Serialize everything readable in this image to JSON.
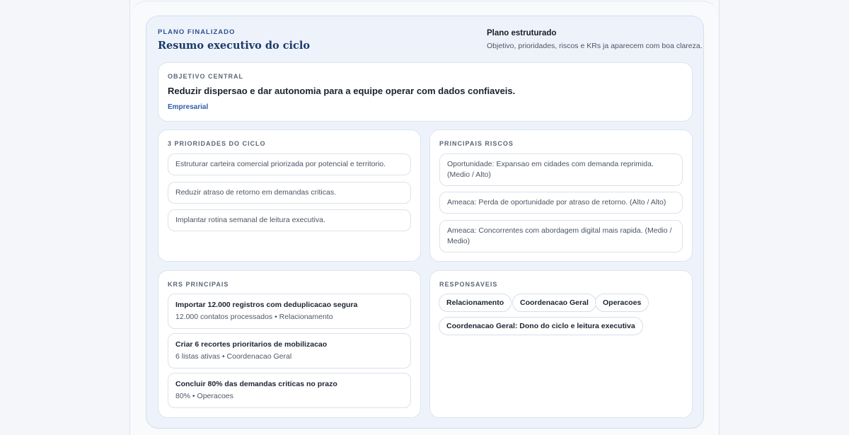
{
  "header": {
    "eyebrow": "PLANO FINALIZADO",
    "title": "Resumo executivo do ciclo",
    "side_title": "Plano estruturado",
    "side_sub": "Objetivo, prioridades, riscos e KRs ja aparecem com boa clareza."
  },
  "objective": {
    "label": "OBJETIVO CENTRAL",
    "text": "Reduzir dispersao e dar autonomia para a equipe operar com dados confiaveis.",
    "tag": "Empresarial"
  },
  "priorities": {
    "label": "3 PRIORIDADES DO CICLO",
    "items": [
      "Estruturar carteira comercial priorizada por potencial e territorio.",
      "Reduzir atraso de retorno em demandas criticas.",
      "Implantar rotina semanal de leitura executiva."
    ]
  },
  "risks": {
    "label": "PRINCIPAIS RISCOS",
    "items": [
      "Oportunidade: Expansao em cidades com demanda reprimida. (Medio / Alto)",
      "Ameaca: Perda de oportunidade por atraso de retorno. (Alto / Alto)",
      "Ameaca: Concorrentes com abordagem digital mais rapida. (Medio / Medio)"
    ]
  },
  "krs": {
    "label": "KRS PRINCIPAIS",
    "items": [
      {
        "title": "Importar 12.000 registros com deduplicacao segura",
        "sub": "12.000 contatos processados • Relacionamento"
      },
      {
        "title": "Criar 6 recortes prioritarios de mobilizacao",
        "sub": "6 listas ativas • Coordenacao Geral"
      },
      {
        "title": "Concluir 80% das demandas criticas no prazo",
        "sub": "80% • Operacoes"
      }
    ]
  },
  "owners": {
    "label": "RESPONSAVEIS",
    "chips": [
      "Relacionamento",
      "Coordenacao Geral",
      "Operacoes"
    ],
    "detail": "Coordenacao Geral: Dono do ciclo e leitura executiva"
  }
}
